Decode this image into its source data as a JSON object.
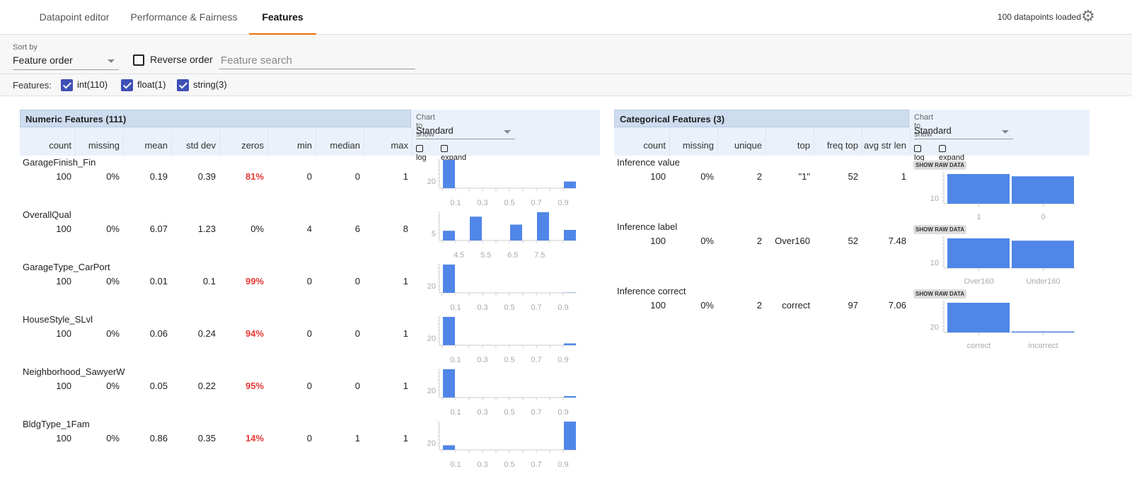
{
  "tabs": [
    "Datapoint editor",
    "Performance & Fairness",
    "Features"
  ],
  "active_tab": 2,
  "status": "100 datapoints loaded",
  "sort": {
    "label": "Sort by",
    "value": "Feature order",
    "reverse_label": "Reverse order",
    "search_placeholder": "Feature search"
  },
  "features_filter": {
    "label": "Features:",
    "items": [
      {
        "label": "int(110)",
        "checked": true
      },
      {
        "label": "float(1)",
        "checked": true
      },
      {
        "label": "string(3)",
        "checked": true
      }
    ]
  },
  "bar_color": "#5086e8",
  "numeric": {
    "title": "Numeric Features (111)",
    "columns": [
      "count",
      "missing",
      "mean",
      "std dev",
      "zeros",
      "min",
      "median",
      "max"
    ],
    "chart_label": "Chart to show",
    "chart_value": "Standard",
    "log_label": "log",
    "expand_label": "expand",
    "rows": [
      {
        "name": "GarageFinish_Fin",
        "values": [
          "100",
          "0%",
          "0.19",
          "0.39",
          "81%",
          "0",
          "0",
          "1"
        ],
        "zeros_alert": true,
        "y_tick": "20",
        "x_ticks": [
          "0.1",
          "0.3",
          "0.5",
          "0.7",
          "0.9"
        ],
        "bins": [
          81,
          0,
          0,
          0,
          0,
          0,
          0,
          0,
          0,
          19
        ]
      },
      {
        "name": "OverallQual",
        "values": [
          "100",
          "0%",
          "6.07",
          "1.23",
          "0%",
          "4",
          "6",
          "8"
        ],
        "zeros_alert": false,
        "y_tick": "5",
        "x_ticks": [
          "4.5",
          "5.5",
          "6.5",
          "7.5"
        ],
        "bins": [
          11,
          0,
          27,
          0,
          0,
          18,
          0,
          32,
          0,
          12
        ]
      },
      {
        "name": "GarageType_CarPort",
        "values": [
          "100",
          "0%",
          "0.01",
          "0.1",
          "99%",
          "0",
          "0",
          "1"
        ],
        "zeros_alert": true,
        "y_tick": "20",
        "x_ticks": [
          "0.1",
          "0.3",
          "0.5",
          "0.7",
          "0.9"
        ],
        "bins": [
          99,
          0,
          0,
          0,
          0,
          0,
          0,
          0,
          0,
          1
        ]
      },
      {
        "name": "HouseStyle_SLvl",
        "values": [
          "100",
          "0%",
          "0.06",
          "0.24",
          "94%",
          "0",
          "0",
          "1"
        ],
        "zeros_alert": true,
        "y_tick": "20",
        "x_ticks": [
          "0.1",
          "0.3",
          "0.5",
          "0.7",
          "0.9"
        ],
        "bins": [
          94,
          0,
          0,
          0,
          0,
          0,
          0,
          0,
          0,
          6
        ]
      },
      {
        "name": "Neighborhood_SawyerW",
        "values": [
          "100",
          "0%",
          "0.05",
          "0.22",
          "95%",
          "0",
          "0",
          "1"
        ],
        "zeros_alert": true,
        "y_tick": "20",
        "x_ticks": [
          "0.1",
          "0.3",
          "0.5",
          "0.7",
          "0.9"
        ],
        "bins": [
          95,
          0,
          0,
          0,
          0,
          0,
          0,
          0,
          0,
          5
        ]
      },
      {
        "name": "BldgType_1Fam",
        "values": [
          "100",
          "0%",
          "0.86",
          "0.35",
          "14%",
          "0",
          "1",
          "1"
        ],
        "zeros_alert": true,
        "y_tick": "20",
        "x_ticks": [
          "0.1",
          "0.3",
          "0.5",
          "0.7",
          "0.9"
        ],
        "bins": [
          14,
          0,
          0,
          0,
          0,
          0,
          0,
          0,
          0,
          86
        ]
      }
    ]
  },
  "categorical": {
    "title": "Categorical Features (3)",
    "columns": [
      "count",
      "missing",
      "unique",
      "top",
      "freq top",
      "avg str len"
    ],
    "chart_label": "Chart to show",
    "chart_value": "Standard",
    "log_label": "log",
    "expand_label": "expand",
    "raw_label": "SHOW RAW DATA",
    "rows": [
      {
        "name": "Inference value",
        "values": [
          "100",
          "0%",
          "2",
          "\"1\"",
          "52",
          "1"
        ],
        "y_tick": "10",
        "categories": [
          "1",
          "0"
        ],
        "counts": [
          52,
          48
        ]
      },
      {
        "name": "Inference label",
        "values": [
          "100",
          "0%",
          "2",
          "Over160",
          "52",
          "7.48"
        ],
        "y_tick": "10",
        "categories": [
          "Over160",
          "Under160"
        ],
        "counts": [
          52,
          48
        ]
      },
      {
        "name": "Inference correct",
        "values": [
          "100",
          "0%",
          "2",
          "correct",
          "97",
          "7.06"
        ],
        "y_tick": "20",
        "categories": [
          "correct",
          "incorrect"
        ],
        "counts": [
          97,
          3
        ]
      }
    ]
  }
}
